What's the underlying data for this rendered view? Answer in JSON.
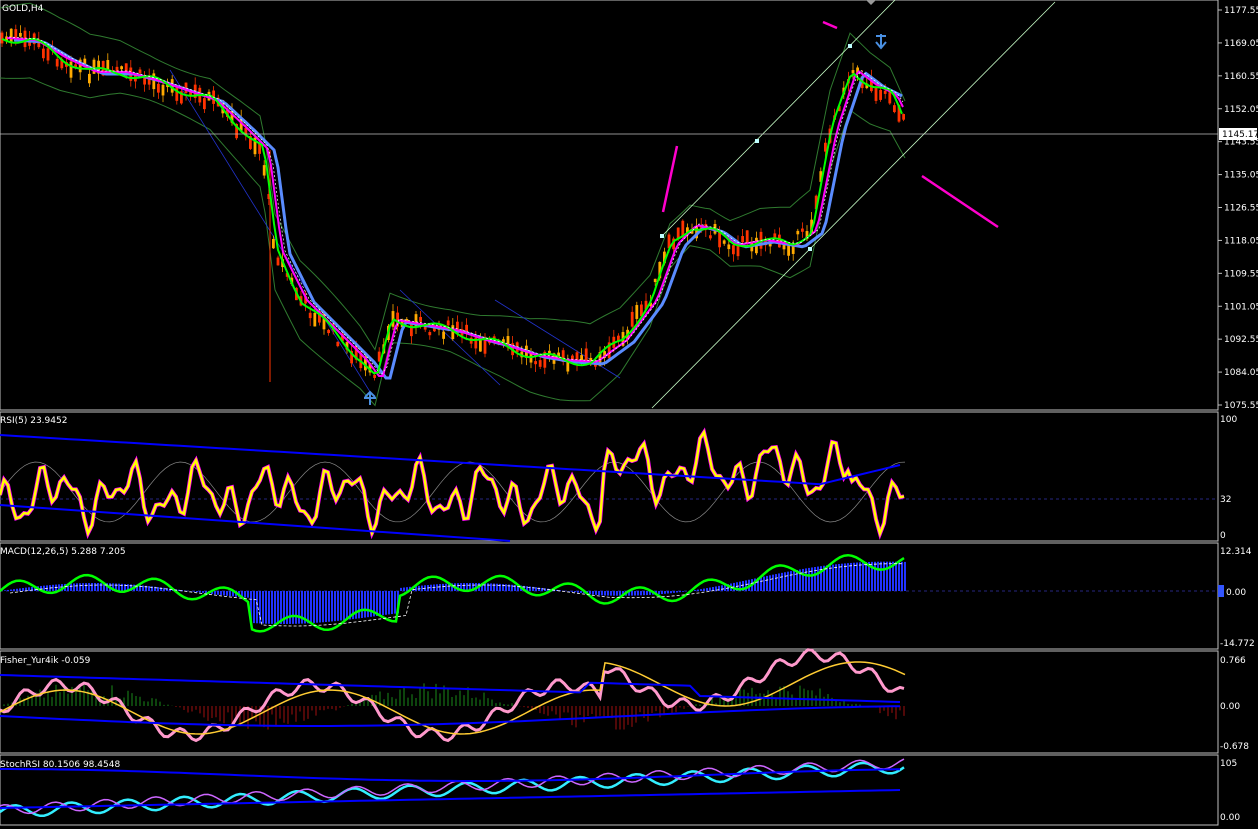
{
  "chart_header": "GOLD,H4",
  "current_price": "1145.17",
  "price_axis": {
    "ticks": [
      "1177.55",
      "1169.05",
      "1160.55",
      "1152.05",
      "1143.55",
      "1135.05",
      "1126.55",
      "1118.05",
      "1109.55",
      "1101.05",
      "1092.55",
      "1084.05",
      "1075.55"
    ],
    "min": 1075.55,
    "max": 1177.55
  },
  "subwindows": [
    {
      "id": "rsi",
      "label": "RSI(5) 23.9452",
      "ticks": [
        "100",
        "32",
        "0"
      ]
    },
    {
      "id": "macd",
      "label": "MACD(12,26,5) 5.288 7.205",
      "ticks": [
        "12.314",
        "0.00",
        "-14.772"
      ]
    },
    {
      "id": "fisher",
      "label": "Fisher_Yur4ik -0.059",
      "ticks": [
        "0.766",
        "0.00",
        "-0.678"
      ]
    },
    {
      "id": "stoch",
      "label": "StochRSI 80.1506 98.4548",
      "ticks": [
        "105",
        "0.00"
      ]
    }
  ],
  "colors": {
    "background": "#000000",
    "grid_line": "#c0c0c0",
    "candle_up": "#ffaa00",
    "candle_down": "#ff3300",
    "ma_fast": "#00ff00",
    "ma_mid": "#ff00ff",
    "ma_slow": "#5a8cff",
    "bands": "#2f7a2f",
    "rsi_line": "#ffff00",
    "indicator_blue": "#0000ff",
    "macd_line": "#00ff00",
    "annotation": "#ff00cc",
    "arrow": "#4a90e2"
  },
  "arrows": [
    {
      "name": "down-arrow-top",
      "direction": "down"
    },
    {
      "name": "up-arrow-low",
      "direction": "up"
    }
  ]
}
